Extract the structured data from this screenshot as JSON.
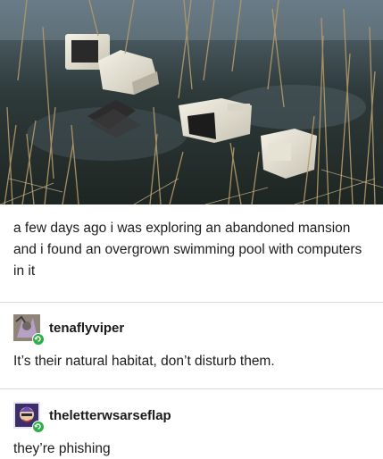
{
  "post": {
    "text": "a few days ago i was exploring an abandoned mansion and i found an overgrown swimming pool with computers in it"
  },
  "reblogs": [
    {
      "username": "tenaflyviper",
      "text": "It’s their natural habitat, don’t disturb them."
    },
    {
      "username": "theletterwsarseflap",
      "text": "they’re phishing"
    }
  ]
}
